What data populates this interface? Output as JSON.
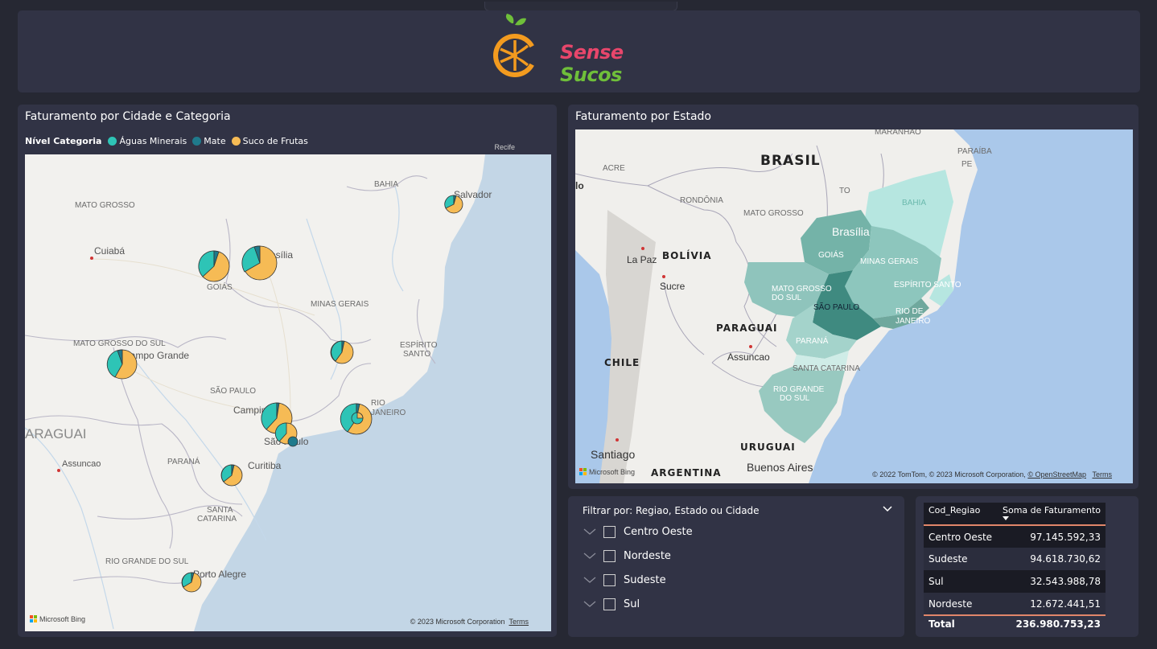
{
  "header": {
    "brand_word1": "Sense",
    "brand_word2": "Sucos"
  },
  "city_panel": {
    "title": "Faturamento por Cidade e Categoria",
    "legend_title": "Nível Categoria",
    "legend": [
      {
        "label": "Águas Minerais",
        "color": "#2ec4b6"
      },
      {
        "label": "Mate",
        "color": "#1f7a8c"
      },
      {
        "label": "Suco de Frutas",
        "color": "#f6bb55"
      }
    ],
    "map_labels": {
      "mato_grosso": "MATO GROSSO",
      "bahia": "BAHIA",
      "salvador": "Salvador",
      "cuiaba": "Cuiabá",
      "brasilia": "Brasília",
      "goias": "GOIÁS",
      "minas": "MINAS GERAIS",
      "ms": "MATO GROSSO DO SUL",
      "campo_grande": "Campo Grande",
      "es1": "ESPÍRITO",
      "es2": "SANTO",
      "sp_state": "SÃO PAULO",
      "campinas": "Campinas",
      "rio1": "RIO",
      "rio2": "JANEIRO",
      "sao_paulo": "São Paulo",
      "paraguai": "ARAGUAI",
      "assuncao": "Assuncao",
      "parana": "PARANÁ",
      "curitiba": "Curitiba",
      "sc1": "SANTA",
      "sc2": "CATARINA",
      "rgs": "RIO GRANDE DO SUL",
      "porto_alegre": "Porto Alegre",
      "recife": "Recife"
    },
    "bing_label": "Microsoft Bing",
    "attribution": "© 2023 Microsoft Corporation",
    "terms": "Terms"
  },
  "state_panel": {
    "title": "Faturamento por Estado",
    "map_labels": {
      "brasil": "BRASIL",
      "maranhao": "MARANHÃO",
      "paraiba": "PARAÍBA",
      "acre": "ACRE",
      "pe": "PE",
      "to": "TO",
      "rondonia": "RONDÔNIA",
      "bahia": "BAHIA",
      "mato_grosso": "MATO GROSSO",
      "brasilia": "Brasília",
      "la_paz": "La Paz",
      "bolivia": "BOLÍVIA",
      "goias": "GOIÁS",
      "minas": "MINAS GERAIS",
      "sucre": "Sucre",
      "ms1": "MATO GROSSO",
      "ms2": "DO SUL",
      "es": "ESPÍRITO SANTO",
      "sp": "SÃO PAULO",
      "rio1": "RIO DE",
      "rio2": "JANEIRO",
      "paraguai": "PARAGUAI",
      "assuncao": "Assuncao",
      "chile": "CHILE",
      "parana": "PARANÁ",
      "sc": "SANTA CATARINA",
      "rgs1": "RIO GRANDE",
      "rgs2": "DO SUL",
      "santiago": "Santiago",
      "uruguai": "URUGUAI",
      "argentina": "ARGENTINA",
      "buenos_aires": "Buenos Aires",
      "lo": "lo"
    },
    "bing_label": "Microsoft Bing",
    "attribution": "© 2022 TomTom, © 2023 Microsoft Corporation,",
    "osm": "© OpenStreetMap",
    "terms": "Terms"
  },
  "filter": {
    "title": "Filtrar por: Regiao, Estado ou Cidade",
    "items": [
      "Centro Oeste",
      "Nordeste",
      "Sudeste",
      "Sul"
    ]
  },
  "table": {
    "headers": [
      "Cod_Regiao",
      "Soma de Faturamento"
    ],
    "rows": [
      [
        "Centro Oeste",
        "97.145.592,33"
      ],
      [
        "Sudeste",
        "94.618.730,62"
      ],
      [
        "Sul",
        "32.543.988,78"
      ],
      [
        "Nordeste",
        "12.672.441,51"
      ]
    ],
    "total_label": "Total",
    "total_value": "236.980.753,23"
  }
}
